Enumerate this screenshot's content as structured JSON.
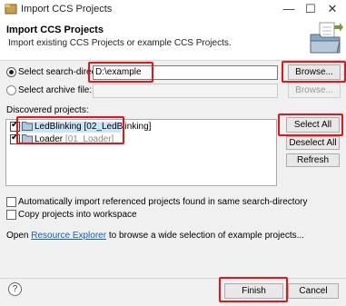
{
  "window": {
    "title": "Import CCS Projects",
    "minimize": "—",
    "maximize": "☐",
    "close": "✕"
  },
  "header": {
    "title": "Import CCS Projects",
    "description": "Import existing CCS Projects or example CCS Projects."
  },
  "source": {
    "search_dir_label": "Select search-directory:",
    "search_dir_value": "D:\\example",
    "archive_label": "Select archive file:",
    "archive_value": "",
    "browse_label": "Browse...",
    "browse_archive_label": "Browse..."
  },
  "discovered": {
    "label": "Discovered projects:",
    "projects": [
      {
        "name": "LedBlinking",
        "tag": "[02_LedBlinking]",
        "checked": true,
        "selected": true
      },
      {
        "name": "Loader",
        "tag": "[01_Loader]",
        "checked": true,
        "selected": false
      }
    ],
    "select_all": "Select All",
    "deselect_all": "Deselect All",
    "refresh": "Refresh"
  },
  "options": {
    "auto_import": "Automatically import referenced projects found in same search-directory",
    "copy_into_ws": "Copy projects into workspace"
  },
  "explorer": {
    "prefix": "Open ",
    "link": "Resource Explorer",
    "suffix": " to browse a wide selection of example projects..."
  },
  "footer": {
    "help": "?",
    "finish": "Finish",
    "cancel": "Cancel"
  },
  "colors": {
    "highlight": "#e8141b",
    "link": "#0b5fc9",
    "selection": "#cce4f7"
  }
}
